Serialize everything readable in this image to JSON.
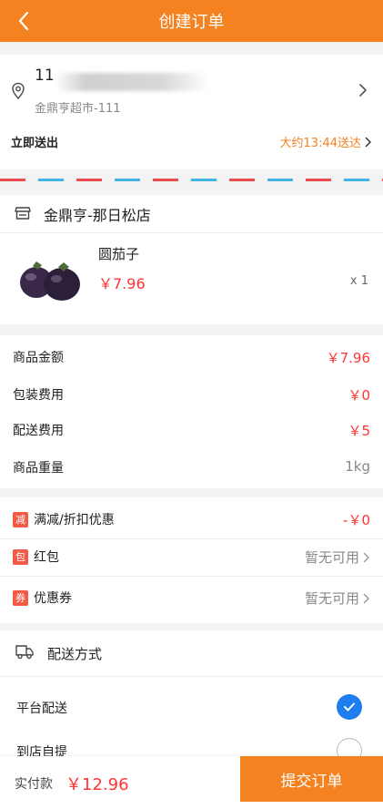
{
  "header": {
    "title": "创建订单"
  },
  "address": {
    "name": "11",
    "sub": "金鼎亨超市-111",
    "deliver_now": "立即送出",
    "eta": "大约13:44送达"
  },
  "store": {
    "name": "金鼎亨-那日松店"
  },
  "product": {
    "name": "圆茄子",
    "price": "￥7.96",
    "qty": "x 1"
  },
  "fees": [
    {
      "label": "商品金额",
      "value": "￥7.96"
    },
    {
      "label": "包装费用",
      "value": "￥0"
    },
    {
      "label": "配送费用",
      "value": "￥5"
    },
    {
      "label": "商品重量",
      "value": "1kg"
    }
  ],
  "discounts": [
    {
      "badge": "减",
      "label": "满减/折扣优惠",
      "value": "-￥0"
    },
    {
      "badge": "包",
      "label": "红包",
      "value": "暂无可用"
    },
    {
      "badge": "券",
      "label": "优惠券",
      "value": "暂无可用"
    }
  ],
  "delivery": {
    "title": "配送方式",
    "options": [
      "平台配送",
      "到店自提"
    ],
    "selected": "平台配送"
  },
  "bottom": {
    "pay_label": "实付款",
    "pay_amount": "￥12.96",
    "submit_label": "提交订单"
  },
  "colors": {
    "accent": "#f58220",
    "price": "#ff3333",
    "selected": "#1e7ef0"
  }
}
